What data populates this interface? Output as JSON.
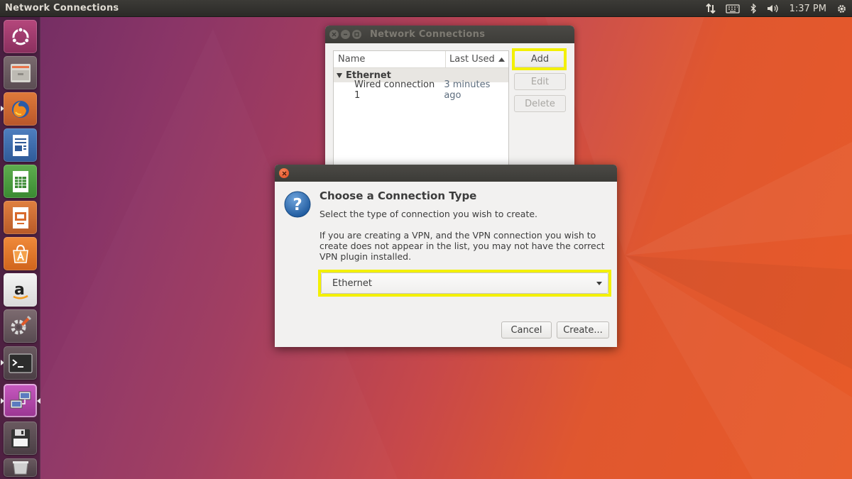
{
  "top_panel": {
    "app_title": "Network Connections",
    "clock": "1:37 PM",
    "indicators": [
      "network-transfer-icon",
      "keyboard-icon",
      "bluetooth-icon",
      "volume-icon",
      "gear-icon"
    ]
  },
  "launcher": {
    "items": [
      "ubuntu-dash-icon",
      "files-icon",
      "firefox-icon",
      "writer-icon",
      "calc-icon",
      "impress-icon",
      "software-center-icon",
      "amazon-icon",
      "system-settings-icon",
      "terminal-icon",
      "network-connections-icon",
      "save-icon",
      "trash-icon"
    ]
  },
  "nc_window": {
    "title": "Network Connections",
    "columns": [
      "Name",
      "Last Used"
    ],
    "group": "Ethernet",
    "connections": [
      {
        "name": "Wired connection 1",
        "last_used": "3 minutes ago"
      }
    ],
    "buttons": {
      "add": "Add",
      "edit": "Edit",
      "delete": "Delete"
    }
  },
  "dialog": {
    "heading": "Choose a Connection Type",
    "subtitle": "Select the type of connection you wish to create.",
    "info": "If you are creating a VPN, and the VPN connection you wish to create does not appear in the list, you may not have the correct VPN plugin installed.",
    "selected_type": "Ethernet",
    "buttons": {
      "cancel": "Cancel",
      "create": "Create..."
    }
  },
  "colors": {
    "highlight": "#f3f000",
    "panel": "#3c3b37",
    "close_button": "#e0481f"
  }
}
